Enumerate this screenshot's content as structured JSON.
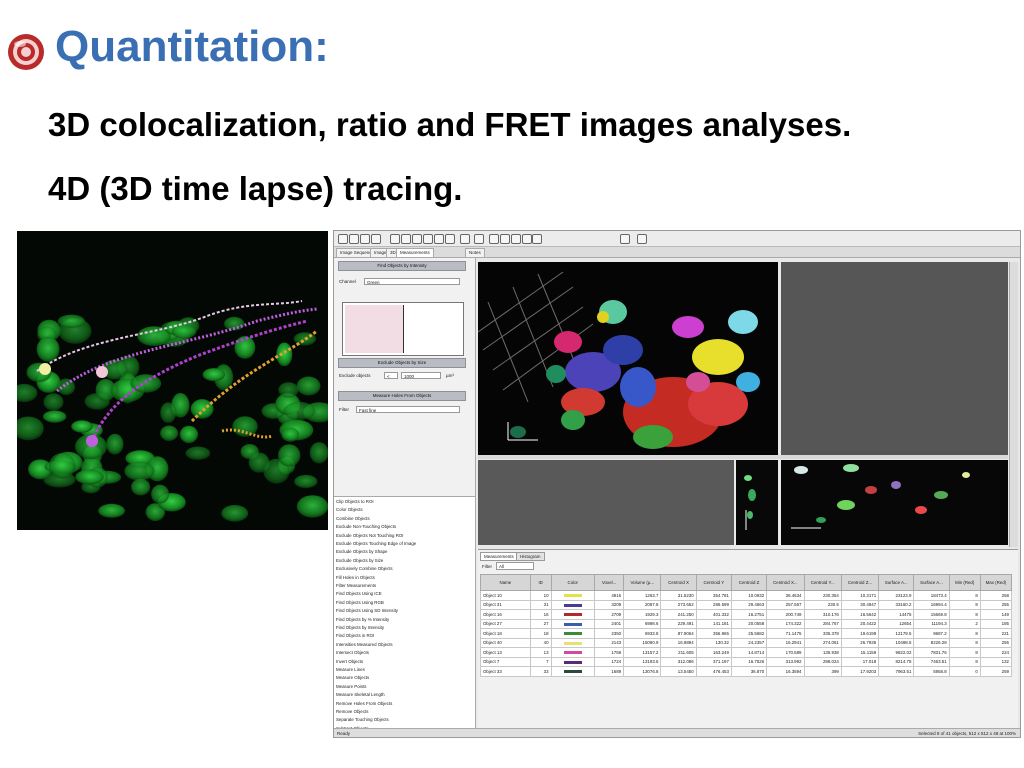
{
  "slide": {
    "title": "Quantitation:",
    "line1": "3D colocalization, ratio and FRET images analyses.",
    "line2": "4D (3D time lapse) tracing."
  },
  "colors": {
    "title": "#3b6fb3",
    "bullet_outer": "#b92a2a",
    "bullet_inner": "#f5d0d0"
  },
  "software": {
    "tabs": [
      "Image Sequence",
      "Image",
      "3D",
      "Measurements",
      "Notes"
    ],
    "panels": {
      "find_objects": "Find Objects by Intensity",
      "channel_label": "Channel",
      "channel_value": "Green",
      "exclude_by_size": "Exclude Objects by Size",
      "exclude_label": "Exclude objects",
      "exclude_op": "<",
      "exclude_value": "1000",
      "exclude_unit": "µm³",
      "measure_holes": "Measure Holes From Objects",
      "fill_label": "Filter",
      "fill_value": "Fast fine"
    },
    "algorithms": [
      "Clip Objects to ROI",
      "Color Objects",
      "Combine Objects",
      "Exclude Non-Touching Objects",
      "Exclude Objects Not Touching ROI",
      "Exclude Objects Touching Edge of Image",
      "Exclude Objects by Shape",
      "Exclude Objects by Size",
      "Exclusively Combine Objects",
      "Fill Holes in Objects",
      "Filter Measurements",
      "Find Objects Using ICE",
      "Find Objects Using RGB",
      "Find Objects Using SD Intensity",
      "Find Objects by % Intensity",
      "Find Objects by Intensity",
      "Find Objects in ROI",
      "Intensities Measured Objects",
      "Intersect Objects",
      "Invert Objects",
      "Measure Lines",
      "Measure Objects",
      "Measure Points",
      "Measure Skeletal Length",
      "Remove Holes From Objects",
      "Remove Objects",
      "Separate Touching Objects",
      "Subtract Objects"
    ],
    "measure_tabs": [
      "Measurements",
      "Histogram"
    ],
    "filter_label": "Filter",
    "filter_value": "All",
    "table_headers": [
      "Name",
      "ID",
      "Color",
      "Voxel...",
      "Volume (µ...",
      "Centroid X",
      "Centroid Y",
      "Centroid Z",
      "Centroid X...",
      "Centroid Y...",
      "Centroid Z...",
      "Surface A...",
      "Surface A...",
      "Min (Red)",
      "Max (Red)"
    ],
    "rows": [
      [
        "Object 10",
        "10",
        "#e6e04a",
        "4916",
        "1263.7",
        "31.5230",
        "354.781",
        "10.0932",
        "36.4634",
        "230.354",
        "10.3171",
        "23123.9",
        "18473.4",
        "8",
        "258"
      ],
      [
        "Object 31",
        "31",
        "#4a3a9a",
        "3209",
        "2087.8",
        "273.652",
        "286.599",
        "29.4663",
        "257.567",
        "230.5",
        "30.4947",
        "33160.2",
        "16994.4",
        "8",
        "255"
      ],
      [
        "Object 16",
        "16",
        "#b02a2a",
        "2709",
        "1929.3",
        "241.250",
        "401.332",
        "16.2751",
        "200.749",
        "310.176",
        "16.5642",
        "14475",
        "15669.8",
        "8",
        "149"
      ],
      [
        "Object 27",
        "27",
        "#3a5fa8",
        "2401",
        "6998.6",
        "229.491",
        "141.181",
        "20.0558",
        "174.322",
        "284.767",
        "20.4422",
        "12654",
        "11194.3",
        "2",
        "185"
      ],
      [
        "Object 18",
        "18",
        "#3a8a3a",
        "2350",
        "6933.8",
        "87.9064",
        "356.965",
        "25.5682",
        "71.1475",
        "335.378",
        "19.6199",
        "12179.5",
        "9687.2",
        "8",
        "221"
      ],
      [
        "Object 40",
        "40",
        "#e8e070",
        "2143",
        "15090.9",
        "16.9894",
        "130.32",
        "24.2357",
        "16.2941",
        "274.061",
        "26.7935",
        "10498.5",
        "8226.28",
        "8",
        "255"
      ],
      [
        "Object 13",
        "13",
        "#d24aa0",
        "1759",
        "13157.2",
        "211.605",
        "163.249",
        "14.8714",
        "170.589",
        "135.938",
        "15.1159",
        "9822.02",
        "7831.76",
        "8",
        "224"
      ],
      [
        "Object 7",
        "7",
        "#5a2a7a",
        "1724",
        "13193.6",
        "312.086",
        "371.197",
        "16.7526",
        "313.992",
        "298.024",
        "17.018",
        "8214.75",
        "7463.51",
        "8",
        "132"
      ],
      [
        "Object 33",
        "33",
        "#2a4a3a",
        "1689",
        "13076.8",
        "13.5450",
        "476.453",
        "36.870",
        "16.3594",
        "399",
        "17.9203",
        "7963.51",
        "5958.8",
        "0",
        "259"
      ]
    ],
    "status_left": "Ready",
    "status_right": "Selected 9 of 41 objects, 512 x 512 x 48 at 100%"
  }
}
